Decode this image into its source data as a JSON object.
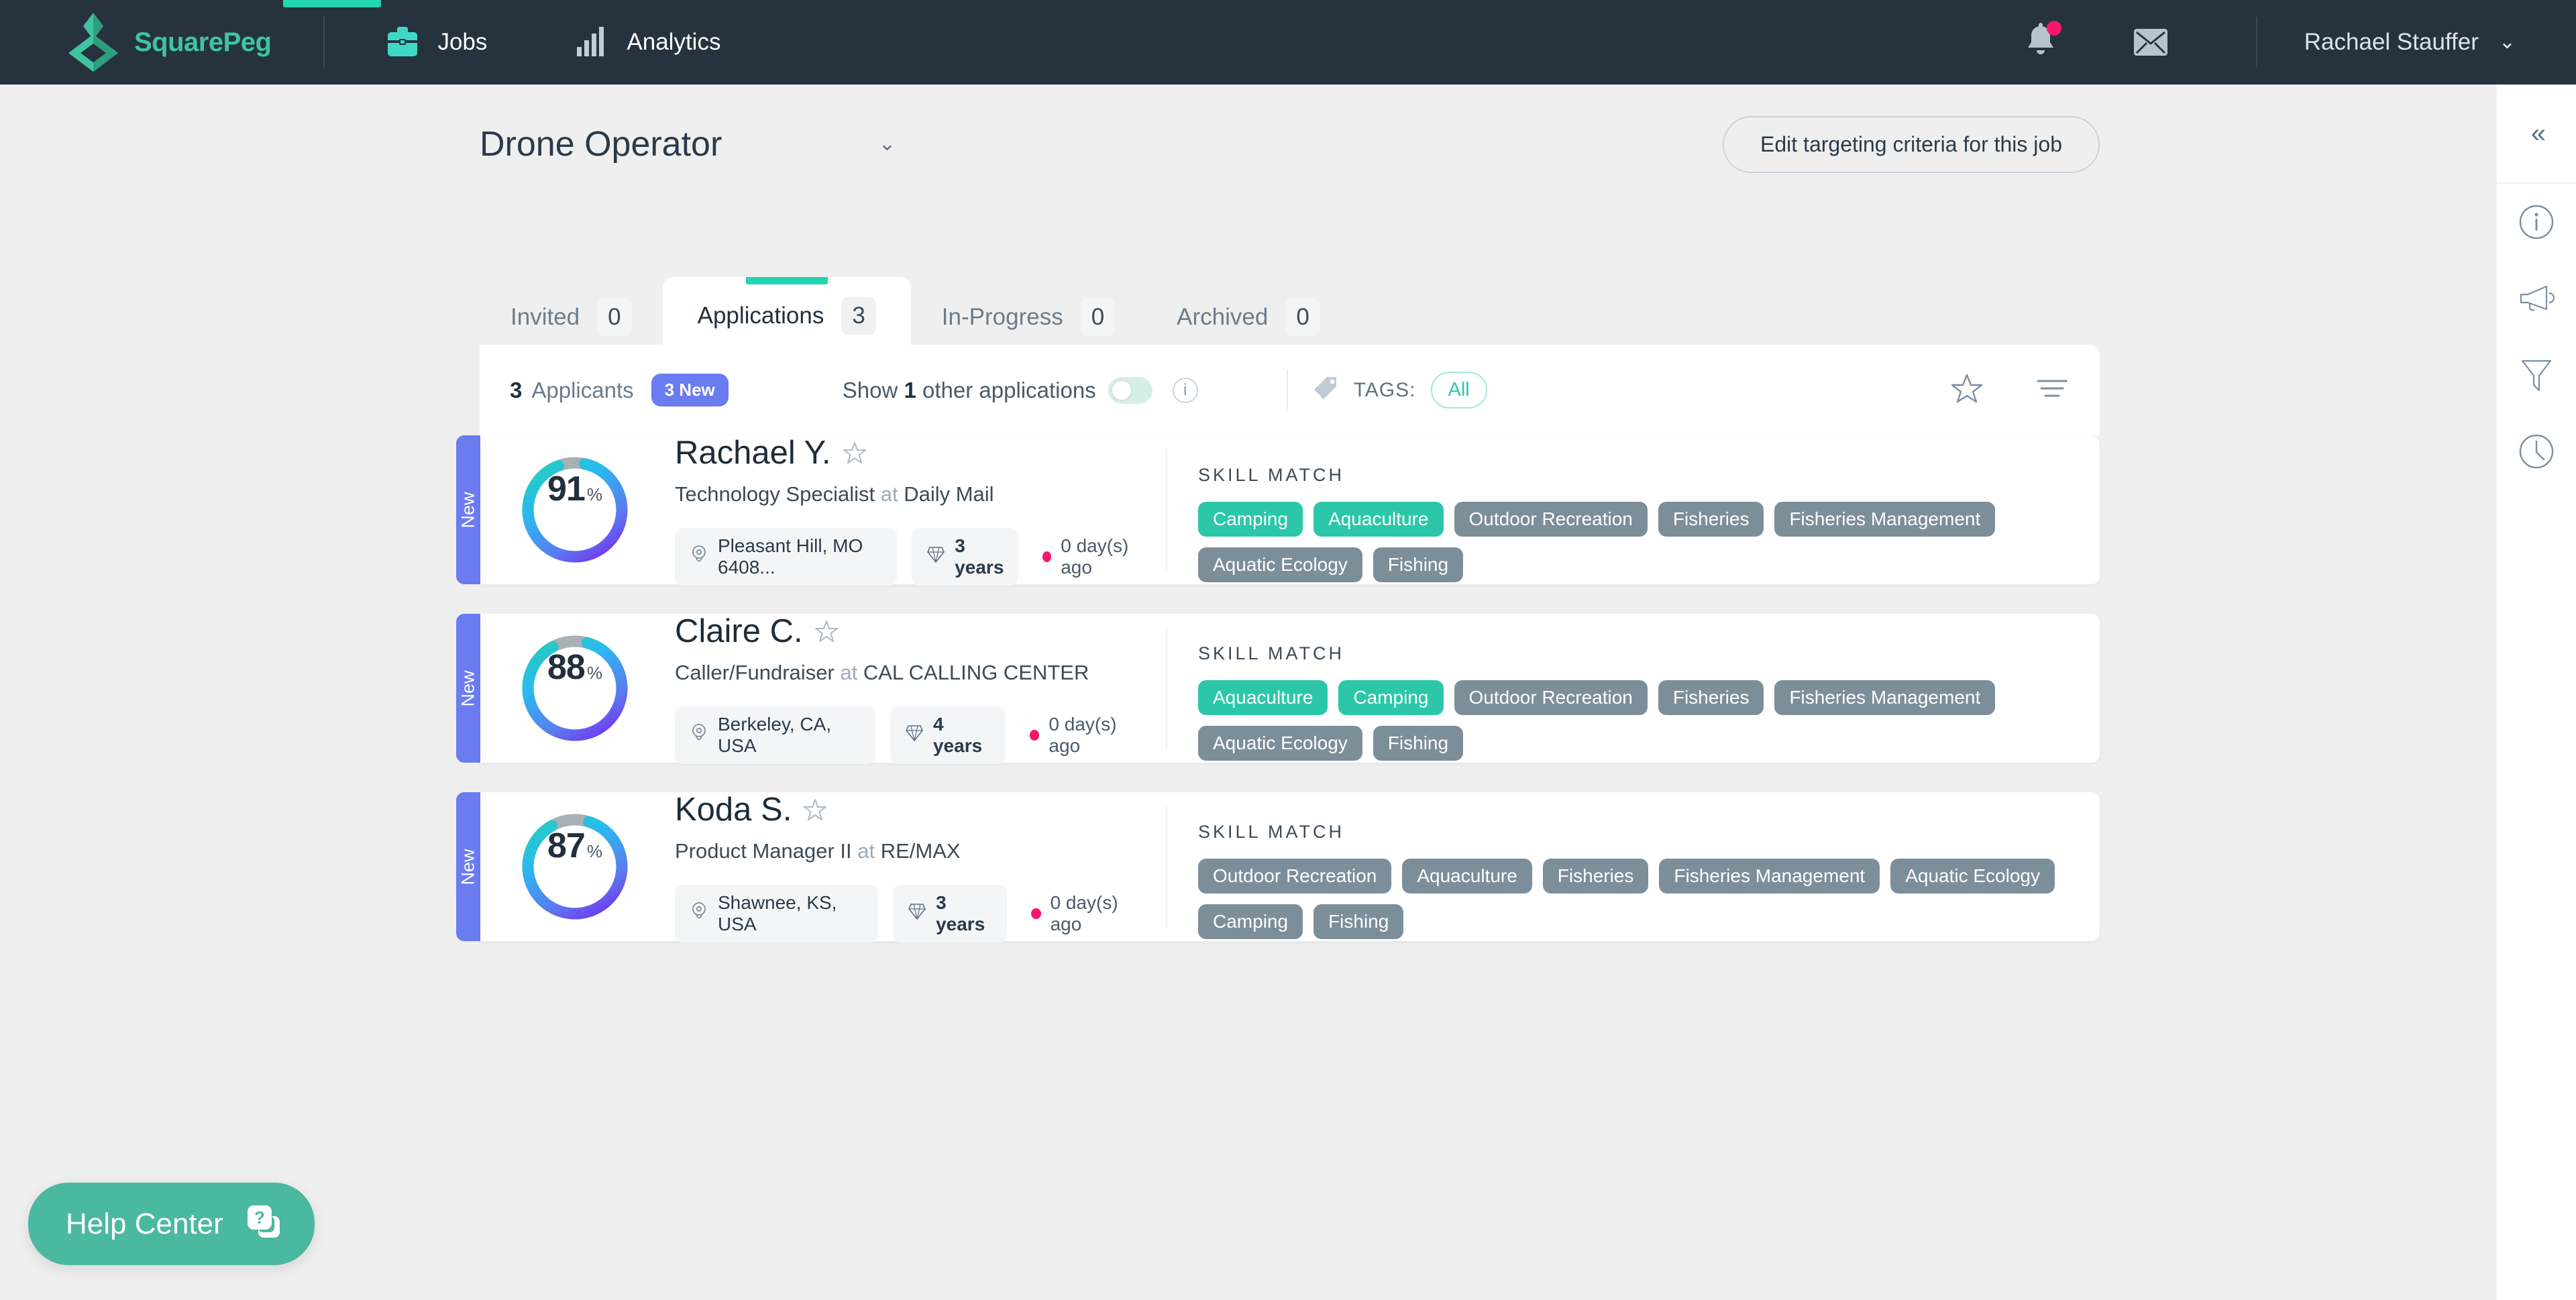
{
  "app": {
    "brand_name": "SquarePeg",
    "nav_items": [
      {
        "label": "Jobs",
        "icon": "briefcase-icon",
        "active": true
      },
      {
        "label": "Analytics",
        "icon": "bar-chart-icon",
        "active": false
      }
    ],
    "user_name": "Rachael Stauffer",
    "notifications_icon": "bell-icon",
    "messages_icon": "envelope-icon",
    "user_caret": "⌄",
    "accent_teal": "#21D6B0",
    "nav_background": "#26333F"
  },
  "page": {
    "job_title": "Drone Operator",
    "job_caret": "⌄",
    "edit_criteria_label": "Edit targeting criteria for this job"
  },
  "tabs": [
    {
      "label": "Invited",
      "count": "0",
      "active": false
    },
    {
      "label": "Applications",
      "count": "3",
      "active": true
    },
    {
      "label": "In-Progress",
      "count": "0",
      "active": false
    },
    {
      "label": "Archived",
      "count": "0",
      "active": false
    }
  ],
  "toolbar": {
    "applicants_count": "3",
    "applicants_label": "Applicants",
    "new_badge": "3 New",
    "show_other_prefix": "Show ",
    "show_other_count": "1",
    "show_other_suffix": " other applications",
    "toggle_state": "off",
    "info_glyph": "i",
    "tags_label": "TAGS:",
    "tags_value": "All",
    "star_icon": "star-outline-icon",
    "sort_icon": "sort-lines-icon"
  },
  "candidates": [
    {
      "badge": "New",
      "score": "91",
      "score_pct": "%",
      "name": "Rachael Y.",
      "role": "Technology Specialist",
      "at": " at ",
      "company": "Daily Mail",
      "location": "Pleasant Hill, MO 6408...",
      "experience": "3 years",
      "applied_ago": "0 day(s) ago",
      "skill_title": "SKILL MATCH",
      "skills": [
        {
          "label": "Camping",
          "matched": true
        },
        {
          "label": "Aquaculture",
          "matched": true
        },
        {
          "label": "Outdoor Recreation",
          "matched": false
        },
        {
          "label": "Fisheries",
          "matched": false
        },
        {
          "label": "Fisheries Management",
          "matched": false
        },
        {
          "label": "Aquatic Ecology",
          "matched": false
        },
        {
          "label": "Fishing",
          "matched": false
        }
      ]
    },
    {
      "badge": "New",
      "score": "88",
      "score_pct": "%",
      "name": "Claire C.",
      "role": "Caller/Fundraiser",
      "at": " at ",
      "company": "CAL CALLING CENTER",
      "location": "Berkeley, CA, USA",
      "experience": "4 years",
      "applied_ago": "0 day(s) ago",
      "skill_title": "SKILL MATCH",
      "skills": [
        {
          "label": "Aquaculture",
          "matched": true
        },
        {
          "label": "Camping",
          "matched": true
        },
        {
          "label": "Outdoor Recreation",
          "matched": false
        },
        {
          "label": "Fisheries",
          "matched": false
        },
        {
          "label": "Fisheries Management",
          "matched": false
        },
        {
          "label": "Aquatic Ecology",
          "matched": false
        },
        {
          "label": "Fishing",
          "matched": false
        }
      ]
    },
    {
      "badge": "New",
      "score": "87",
      "score_pct": "%",
      "name": "Koda S.",
      "role": "Product Manager II",
      "at": " at ",
      "company": "RE/MAX",
      "location": "Shawnee, KS, USA",
      "experience": "3 years",
      "applied_ago": "0 day(s) ago",
      "skill_title": "SKILL MATCH",
      "skills": [
        {
          "label": "Outdoor Recreation",
          "matched": false
        },
        {
          "label": "Aquaculture",
          "matched": false
        },
        {
          "label": "Fisheries",
          "matched": false
        },
        {
          "label": "Fisheries Management",
          "matched": false
        },
        {
          "label": "Aquatic Ecology",
          "matched": false
        },
        {
          "label": "Camping",
          "matched": false
        },
        {
          "label": "Fishing",
          "matched": false
        }
      ]
    }
  ],
  "right_rail": {
    "collapse_glyph": "«",
    "icons": [
      {
        "name": "info-circle-icon"
      },
      {
        "name": "megaphone-icon"
      },
      {
        "name": "funnel-filter-icon"
      },
      {
        "name": "clock-history-icon"
      }
    ]
  },
  "help_center": {
    "label": "Help Center",
    "icon": "question-card-icon",
    "color": "#4BB8A0"
  }
}
